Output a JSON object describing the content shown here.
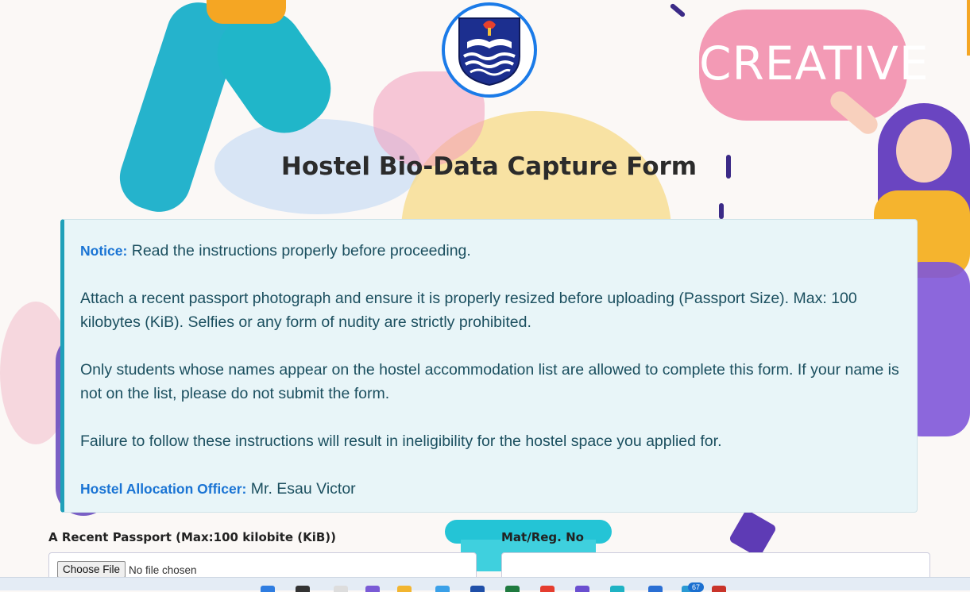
{
  "header": {
    "title": "Hostel Bio-Data Capture Form"
  },
  "background": {
    "creative_text": "CREATIVE"
  },
  "notice": {
    "heading_label": "Notice:",
    "heading_text": " Read the instructions properly before proceeding.",
    "paragraph_passport": "Attach a recent passport photograph and ensure it is properly resized before uploading (Passport Size). Max: 100 kilobytes (KiB). Selfies or any form of nudity are strictly prohibited.",
    "paragraph_eligibility": "Only students whose names appear on the hostel accommodation list are allowed to complete this form. If your name is not on the list, please do not submit the form.",
    "paragraph_failure": "Failure to follow these instructions will result in ineligibility for the hostel space you applied for.",
    "officer_label": "Hostel Allocation Officer:",
    "officer_name": " Mr. Esau Victor"
  },
  "form": {
    "passport_label": "A Recent Passport (Max:100 kilobite (KiB))",
    "passport_button": "Choose File",
    "passport_status": "No file chosen",
    "matno_label": "Mat/Reg. No",
    "matno_value": ""
  },
  "taskbar": {
    "badge_count": "67"
  },
  "colors": {
    "accent": "#1a74d4",
    "notice_bg": "#e8f5f8",
    "notice_border": "#1fa0b9",
    "logo_ring": "#1b7be8"
  }
}
